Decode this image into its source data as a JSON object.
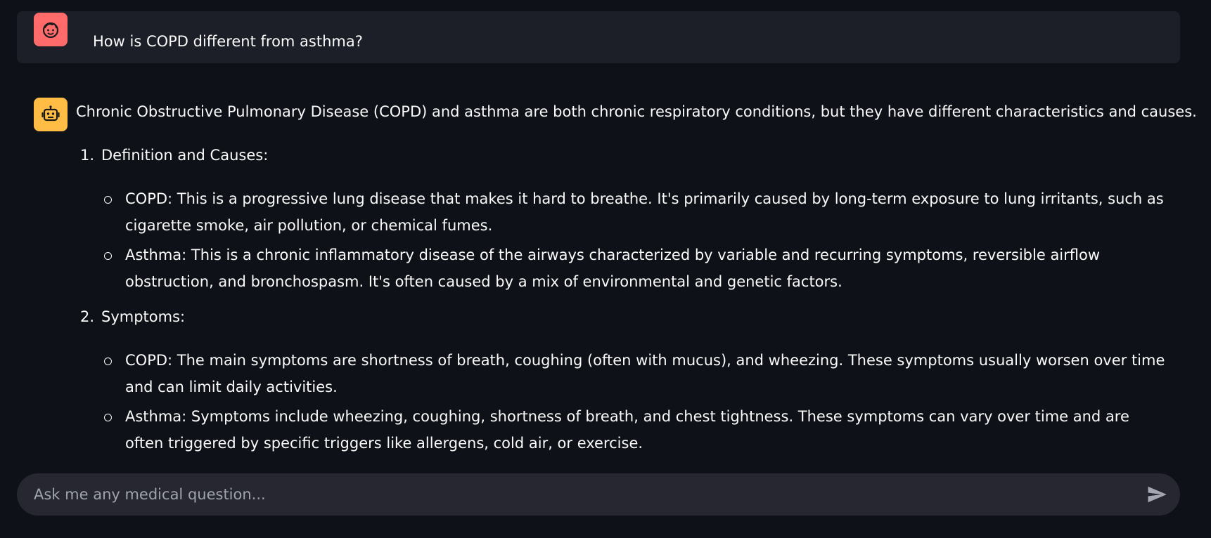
{
  "user_message": {
    "text": "How is COPD different from asthma?",
    "avatar_icon": "face-icon",
    "avatar_color": "#ff6b6b"
  },
  "assistant_message": {
    "avatar_icon": "robot-icon",
    "avatar_color": "#ffbd45",
    "intro": "Chronic Obstructive Pulmonary Disease (COPD) and asthma are both chronic respiratory conditions, but they have different characteristics and causes.",
    "sections": [
      {
        "number": "1.",
        "title": "Definition and Causes:",
        "bullets": [
          "COPD: This is a progressive lung disease that makes it hard to breathe. It's primarily caused by long-term exposure to lung irritants, such as cigarette smoke, air pollution, or chemical fumes.",
          "Asthma: This is a chronic inflammatory disease of the airways characterized by variable and recurring symptoms, reversible airflow obstruction, and bronchospasm. It's often caused by a mix of environmental and genetic factors."
        ]
      },
      {
        "number": "2.",
        "title": "Symptoms:",
        "bullets": [
          "COPD: The main symptoms are shortness of breath, coughing (often with mucus), and wheezing. These symptoms usually worsen over time and can limit daily activities.",
          "Asthma: Symptoms include wheezing, coughing, shortness of breath, and chest tightness. These symptoms can vary over time and are often triggered by specific triggers like allergens, cold air, or exercise."
        ]
      }
    ]
  },
  "chat_input": {
    "placeholder": "Ask me any medical question...",
    "value": "",
    "send_icon": "send-icon"
  },
  "colors": {
    "background": "#0e1117",
    "user_bubble": "#1c1f27",
    "input_bg": "#262730",
    "text": "#fafafa"
  }
}
